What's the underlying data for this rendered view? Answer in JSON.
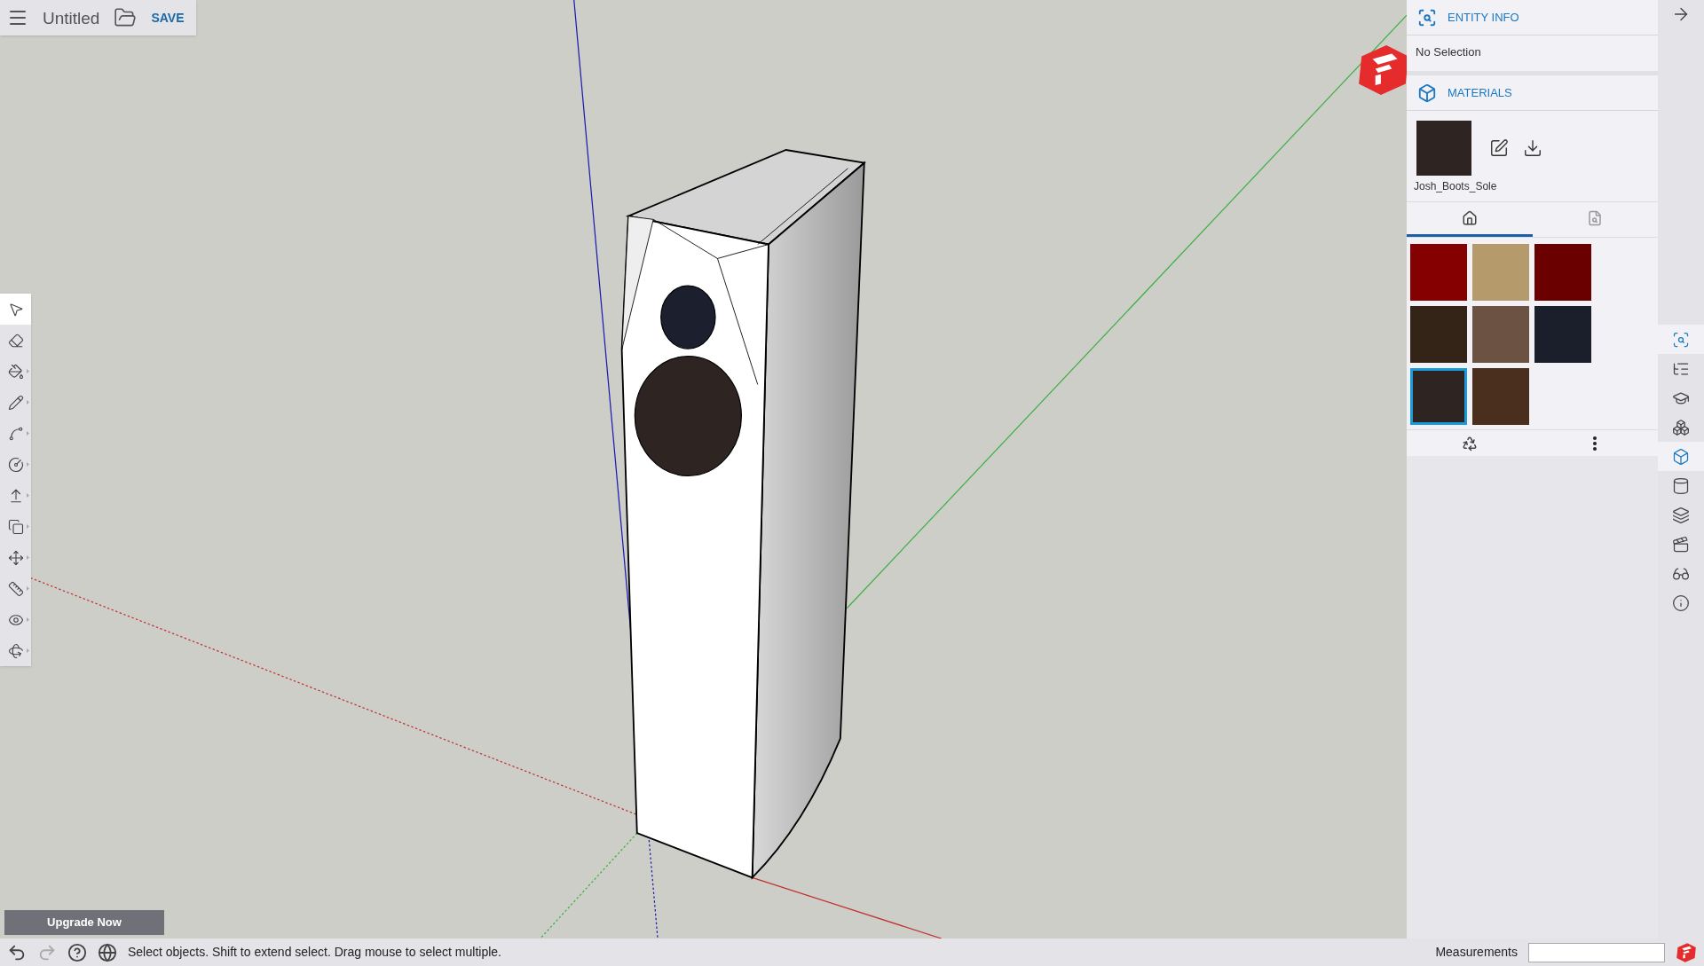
{
  "document": {
    "title": "Untitled",
    "save_label": "SAVE"
  },
  "tools": [
    {
      "kind": "select",
      "selected": true
    },
    {
      "kind": "eraser",
      "selected": false
    },
    {
      "kind": "paint",
      "selected": false
    },
    {
      "kind": "pencil",
      "selected": false
    },
    {
      "kind": "arc",
      "selected": false
    },
    {
      "kind": "circle",
      "selected": false
    },
    {
      "kind": "pushpull",
      "selected": false
    },
    {
      "kind": "offset",
      "selected": false
    },
    {
      "kind": "move",
      "selected": false
    },
    {
      "kind": "tape",
      "selected": false
    },
    {
      "kind": "orbit",
      "selected": false
    },
    {
      "kind": "rotate",
      "selected": false
    }
  ],
  "upgrade_button": "Upgrade Now",
  "entity_info": {
    "title": "ENTITY INFO",
    "selection": "No Selection"
  },
  "materials": {
    "title": "MATERIALS",
    "current_name": "Josh_Boots_Sole",
    "tabs": [
      {
        "kind": "home",
        "selected": true
      },
      {
        "kind": "search",
        "selected": false
      }
    ],
    "swatches": [
      {
        "color": "#850000",
        "selected": false
      },
      {
        "color": "#b59a6b",
        "selected": false
      },
      {
        "color": "#6b0000",
        "selected": false
      },
      {
        "color": "#342417",
        "selected": false
      },
      {
        "color": "#6c5242",
        "selected": false
      },
      {
        "color": "#1b1f2c",
        "selected": false
      },
      {
        "color": "#2e2523",
        "selected": true
      },
      {
        "color": "#4a2f1e",
        "selected": false
      }
    ]
  },
  "sidebar_icons": [
    {
      "kind": "entity",
      "selected": true
    },
    {
      "kind": "outliner",
      "selected": false
    },
    {
      "kind": "instructor",
      "selected": false
    },
    {
      "kind": "components",
      "selected": false
    },
    {
      "kind": "materials",
      "selected": true
    },
    {
      "kind": "styles",
      "selected": false
    },
    {
      "kind": "tags",
      "selected": false
    },
    {
      "kind": "scenes",
      "selected": false
    },
    {
      "kind": "display",
      "selected": false
    },
    {
      "kind": "info",
      "selected": false
    }
  ],
  "status": {
    "message": "Select objects. Shift to extend select. Drag mouse to select multiple.",
    "measurements_label": "Measurements"
  }
}
